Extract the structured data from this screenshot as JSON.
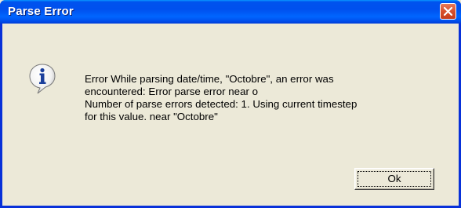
{
  "window": {
    "title": "Parse Error"
  },
  "message": {
    "lines": [
      "Error While parsing date/time, \"Octobre\", an error was",
      "encountered: Error parse error near o",
      "Number of parse errors detected: 1. Using current timestep",
      "for this value. near \"Octobre\""
    ]
  },
  "buttons": {
    "ok_label": "Ok"
  },
  "icons": {
    "title_close": "close-icon",
    "message_icon": "info-icon"
  },
  "colors": {
    "titlebar": "#0053ee",
    "frame": "#0831d9",
    "background": "#ece9d8",
    "close_button": "#d8502b"
  }
}
